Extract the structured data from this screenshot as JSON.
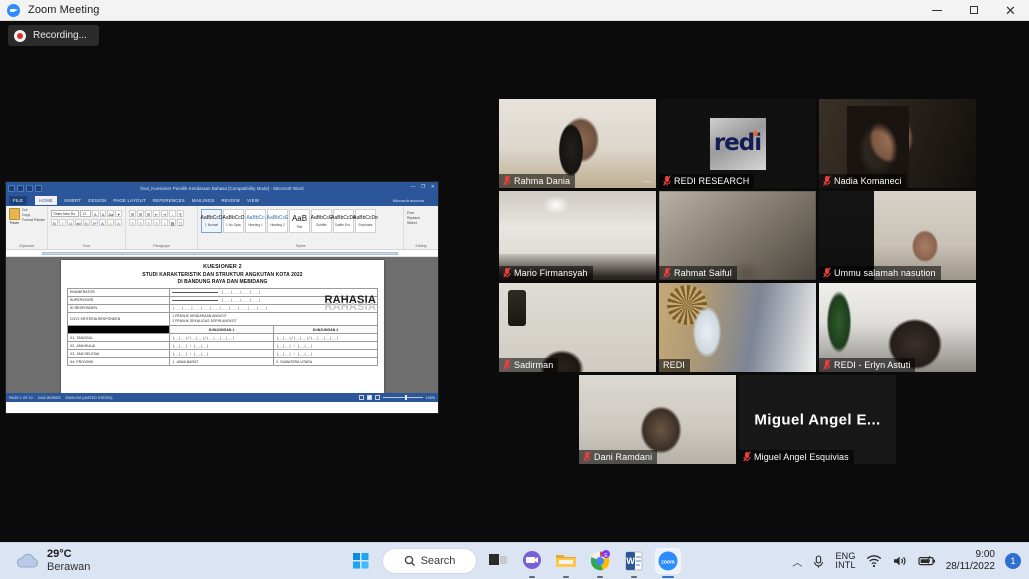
{
  "window": {
    "title": "Zoom Meeting",
    "app_icon": "zoom-video-icon",
    "minimize_label": "Minimize",
    "maximize_label": "Maximize",
    "close_label": "Close"
  },
  "meeting": {
    "recording_label": "Recording...",
    "participants": [
      {
        "name": "Rahma Dania",
        "muted": true,
        "speaking": false,
        "has_more": true,
        "style": "bg-rahma",
        "kind": "video"
      },
      {
        "name": "REDI RESEARCH",
        "muted": true,
        "speaking": false,
        "has_more": false,
        "style": "bg-redi-logo",
        "kind": "logo"
      },
      {
        "name": "Nadia Komaneci",
        "muted": true,
        "speaking": false,
        "has_more": false,
        "style": "bg-nadia",
        "kind": "video"
      },
      {
        "name": "Mario Firmansyah",
        "muted": true,
        "speaking": false,
        "has_more": false,
        "style": "bg-mario",
        "kind": "video"
      },
      {
        "name": "Rahmat Saiful",
        "muted": true,
        "speaking": false,
        "has_more": false,
        "style": "bg-rahmat",
        "kind": "video"
      },
      {
        "name": "Ummu salamah nasution",
        "muted": true,
        "speaking": false,
        "has_more": false,
        "style": "bg-ummu",
        "kind": "video"
      },
      {
        "name": "Sadirman",
        "muted": true,
        "speaking": false,
        "has_more": false,
        "style": "bg-sadirman",
        "kind": "video"
      },
      {
        "name": "REDI",
        "muted": false,
        "speaking": true,
        "has_more": false,
        "style": "bg-redi-speaker",
        "kind": "video"
      },
      {
        "name": "REDI - Erlyn Astuti",
        "muted": true,
        "speaking": false,
        "has_more": false,
        "style": "bg-erlyn",
        "kind": "video"
      },
      {
        "name": "Dani Ramdani",
        "muted": true,
        "speaking": false,
        "has_more": false,
        "style": "bg-dani",
        "kind": "video"
      },
      {
        "name": "Miguel Angel Esquivias",
        "muted": true,
        "speaking": false,
        "has_more": false,
        "style": "tile-dark",
        "kind": "avatar",
        "avatar_text": "Miguel Angel E..."
      }
    ],
    "redi_logo_text": "redi",
    "speaker_border_color": "#d6e63a"
  },
  "word": {
    "title": "final_Kuesioner Pemilik Kendaraan Bahasa [Compatibility Mode] - Microsoft Word",
    "account": "Microsoft account",
    "tabs": [
      "FILE",
      "HOME",
      "INSERT",
      "DESIGN",
      "PAGE LAYOUT",
      "REFERENCES",
      "MAILINGS",
      "REVIEW",
      "VIEW"
    ],
    "active_tab": "HOME",
    "groups": [
      {
        "label": "Clipboard",
        "paste": "Paste",
        "items": [
          "Cut",
          "Copy",
          "Format Painter"
        ]
      },
      {
        "label": "Font",
        "font_name": "Times New Ro",
        "font_size": "12"
      },
      {
        "label": "Paragraph"
      },
      {
        "label": "Styles"
      },
      {
        "label": "Editing",
        "items": [
          "Find",
          "Replace",
          "Select"
        ]
      }
    ],
    "styles": [
      {
        "preview": "AaBbCcD",
        "name": "1 Normal",
        "selected": true
      },
      {
        "preview": "AaBbCcD",
        "name": "1 No Spac"
      },
      {
        "preview": "AaBbCc",
        "name": "Heading 1"
      },
      {
        "preview": "AaBbCcE",
        "name": "Heading 2"
      },
      {
        "preview": "AaB",
        "name": "Title"
      },
      {
        "preview": "AaBbCcE",
        "name": "Subtitle"
      },
      {
        "preview": "AaBbCcDe",
        "name": "Subtle Em..."
      },
      {
        "preview": "AaBbCcDe",
        "name": "Emphasis"
      }
    ],
    "status": {
      "page": "PAGE 1 OF 10",
      "words": "2442 WORDS",
      "language": "ENGLISH (UNITED STATES)",
      "zoom": "100%"
    },
    "document": {
      "title_line1": "KUESIONER 2",
      "title_line2": "STUDI KARAKTERISTIK DAN STRUKTUR ANGKUTAN KOTA 2022",
      "title_line3": "DI BANDUNG RAYA DAN MEBIDANG",
      "watermark": "RAHASIA",
      "rows": [
        {
          "label": "ENUMERATOR",
          "c1": "LINE+BOXES",
          "c2": ""
        },
        {
          "label": "SUPERVISOR",
          "c1": "LINE+BOXES",
          "c2": ""
        },
        {
          "label": "ID RESPONDEN",
          "c1": "BOXES10",
          "c2": ""
        },
        {
          "label": "COV1  KRITERIA RESPONDEN",
          "c1": "OPTIONS",
          "c2": "",
          "options": [
            "1  PEMILIK KENDARAAN ANGKOT",
            "2  PEMILIK SEKALIGUS SOPIR ANGKOT"
          ]
        }
      ],
      "column_headers": [
        "",
        "KUNJUNGAN 1",
        "KUNJUNGAN 2"
      ],
      "visit_rows": [
        {
          "label": "X1. TANGGAL",
          "v1": "|__|__|/|__|__|/|__|__|__|__|",
          "v2": "|__|__|/|__|__|/|__|__|__|__|"
        },
        {
          "label": "X2. JAM MULAI",
          "v1": "|__|__| : |__|__|",
          "v2": "|__|__| : |__|__|"
        },
        {
          "label": "X3. JAM SELESAI",
          "v1": "|__|__| : |__|__|",
          "v2": "|__|__| : |__|__|"
        },
        {
          "label": "X4. PROVINSI",
          "v1": "1. JAWA BARAT",
          "v2": "2. SUMATERA UTARA"
        }
      ]
    }
  },
  "taskbar": {
    "weather": {
      "temperature": "29°C",
      "condition": "Berawan",
      "icon": "cloud-icon"
    },
    "search_placeholder": "Search",
    "items": [
      {
        "name": "start-button",
        "icon": "windows-logo-icon",
        "running": false
      },
      {
        "name": "search-box",
        "icon": "search-icon",
        "running": false
      },
      {
        "name": "task-view",
        "icon": "task-view-icon",
        "running": false
      },
      {
        "name": "teams",
        "icon": "teams-chat-icon",
        "running": true
      },
      {
        "name": "file-explorer",
        "icon": "folder-icon",
        "running": true
      },
      {
        "name": "chrome",
        "icon": "chrome-icon",
        "running": true
      },
      {
        "name": "word",
        "icon": "word-icon",
        "running": true
      },
      {
        "name": "zoom",
        "icon": "zoom-icon",
        "running": true,
        "active": true
      }
    ],
    "tray": {
      "chevron": "⌃",
      "language_line1": "ENG",
      "language_line2": "INTL",
      "mic": "microphone-icon",
      "wifi": "wifi-icon",
      "volume": "volume-icon",
      "battery": "battery-icon",
      "time": "9:00",
      "date": "28/11/2022",
      "notification_count": "1"
    }
  }
}
